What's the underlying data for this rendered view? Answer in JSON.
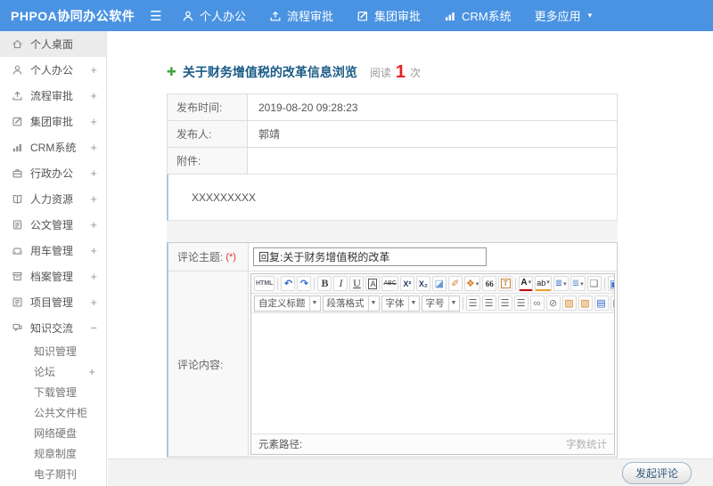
{
  "header": {
    "logo": "PHPOA协同办公软件",
    "menu": [
      {
        "name": "personal-office",
        "label": "个人办公",
        "icon": "user"
      },
      {
        "name": "workflow-approval",
        "label": "流程审批",
        "icon": "upload"
      },
      {
        "name": "group-approval",
        "label": "集团审批",
        "icon": "edit-square"
      },
      {
        "name": "crm-system",
        "label": "CRM系统",
        "icon": "bar-chart"
      },
      {
        "name": "more-apps",
        "label": "更多应用",
        "icon": null,
        "caret": true
      }
    ]
  },
  "sidebar": {
    "items": [
      {
        "name": "personal-desktop",
        "label": "个人桌面",
        "icon": "home",
        "active": true
      },
      {
        "name": "personal-office",
        "label": "个人办公",
        "icon": "user",
        "expander": "+"
      },
      {
        "name": "workflow-approval",
        "label": "流程审批",
        "icon": "upload",
        "expander": "+"
      },
      {
        "name": "group-approval",
        "label": "集团审批",
        "icon": "edit-square",
        "expander": "+"
      },
      {
        "name": "crm-system",
        "label": "CRM系统",
        "icon": "bar-chart",
        "expander": "+"
      },
      {
        "name": "admin-office",
        "label": "行政办公",
        "icon": "briefcase",
        "expander": "+"
      },
      {
        "name": "human-resources",
        "label": "人力资源",
        "icon": "book",
        "expander": "+"
      },
      {
        "name": "document-management",
        "label": "公文管理",
        "icon": "document",
        "expander": "+"
      },
      {
        "name": "vehicle-management",
        "label": "用车管理",
        "icon": "car",
        "expander": "+"
      },
      {
        "name": "archive-management",
        "label": "档案管理",
        "icon": "archive",
        "expander": "+"
      },
      {
        "name": "project-management",
        "label": "项目管理",
        "icon": "project",
        "expander": "+"
      },
      {
        "name": "knowledge-exchange",
        "label": "知识交流",
        "icon": "chat",
        "expander": "−",
        "expanded": true
      }
    ],
    "subitems": [
      {
        "name": "knowledge-management",
        "label": "知识管理"
      },
      {
        "name": "forum",
        "label": "论坛",
        "expander": "+"
      },
      {
        "name": "download-management",
        "label": "下载管理"
      },
      {
        "name": "public-file-cabinet",
        "label": "公共文件柜"
      },
      {
        "name": "network-disk",
        "label": "网络硬盘"
      },
      {
        "name": "rules-regulations",
        "label": "规章制度"
      },
      {
        "name": "e-journal",
        "label": "电子期刊"
      }
    ]
  },
  "article": {
    "title": "关于财务增值税的改革信息浏览",
    "read_label": "阅读",
    "read_count": "1",
    "read_unit": "次",
    "fields": [
      {
        "label": "发布时间:",
        "value": "2019-08-20 09:28:23"
      },
      {
        "label": "发布人:",
        "value": "郭靖"
      },
      {
        "label": "附件:",
        "value": ""
      }
    ],
    "content": "XXXXXXXXX"
  },
  "comment_form": {
    "subject_label": "评论主题:",
    "required_mark": "(*)",
    "subject_value": "回复:关于财务增值税的改革",
    "content_label": "评论内容:",
    "editor": {
      "toolbar1_groups": [
        [
          "html-source"
        ],
        [
          "undo",
          "redo"
        ],
        [
          "bold",
          "italic",
          "underline",
          "char-border",
          "strikethrough",
          "superscript",
          "subscript",
          "eraser",
          "format-brush",
          "text-style",
          "blockquote",
          "paste-text"
        ],
        [
          "font-color",
          "highlight",
          "ordered-list",
          "unordered-list",
          "new-page"
        ],
        [
          "fullscreen"
        ]
      ],
      "toolbar2_selects": [
        {
          "name": "custom-heading",
          "label": "自定义标题"
        },
        {
          "name": "paragraph-format",
          "label": "段落格式"
        },
        {
          "name": "font-family",
          "label": "字体"
        },
        {
          "name": "font-size",
          "label": "字号"
        }
      ],
      "toolbar2_buttons": [
        "align-left",
        "align-center",
        "align-right",
        "align-justify",
        "link",
        "unlink",
        "image",
        "image-upload",
        "media",
        "table"
      ],
      "status_left": "元素路径:",
      "status_right": "字数统计"
    },
    "submit_label": "发起评论"
  },
  "colors": {
    "header_bg": "#4a93e2",
    "title_color": "#1a5b86",
    "read_count_red": "#e62222",
    "required_red": "#e03030",
    "accent_border_blue": "#a8c8e4"
  }
}
